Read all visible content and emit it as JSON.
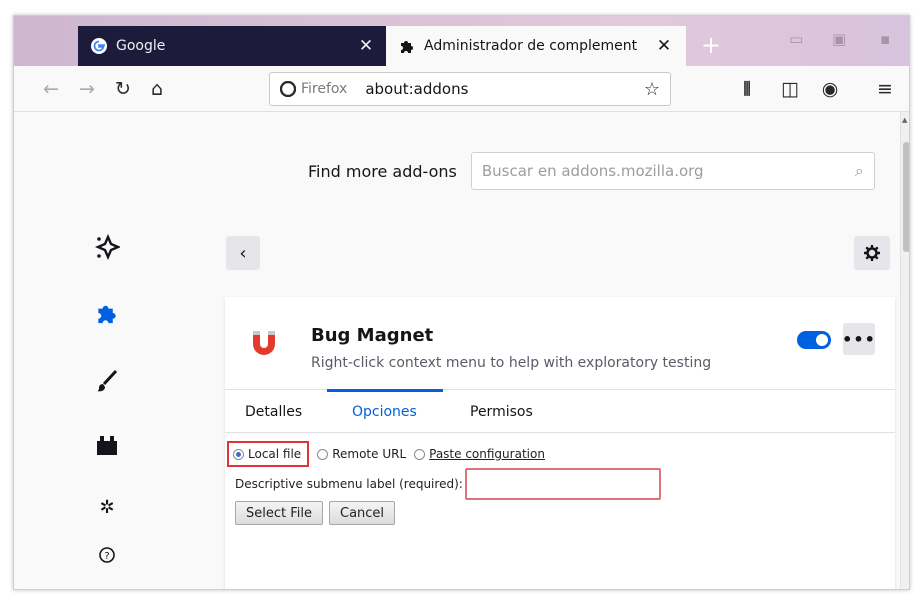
{
  "browser": {
    "tabs": [
      {
        "title": "Google",
        "icon": "google-logo"
      },
      {
        "title": "Administrador de complement",
        "icon": "puzzle-icon"
      }
    ],
    "new_tab_label": "+",
    "url_identity": "Firefox",
    "url": "about:addons"
  },
  "find_more": {
    "label": "Find more add-ons",
    "placeholder": "Buscar en addons.mozilla.org"
  },
  "sidebar": {
    "items": [
      {
        "name": "recommendations",
        "icon": "sparkle-icon"
      },
      {
        "name": "extensions",
        "icon": "puzzle-icon",
        "active": true
      },
      {
        "name": "themes",
        "icon": "brush-icon"
      },
      {
        "name": "plugins",
        "icon": "plugin-block-icon"
      },
      {
        "name": "settings",
        "icon": "gear-icon"
      },
      {
        "name": "help",
        "icon": "help-icon"
      }
    ]
  },
  "addon": {
    "name": "Bug Magnet",
    "description": "Right-click context menu to help with exploratory testing",
    "enabled": true,
    "more_label": "•••"
  },
  "detail_tabs": {
    "details": "Detalles",
    "options": "Opciones",
    "permissions": "Permisos"
  },
  "options_form": {
    "radio_local": "Local file",
    "radio_remote": "Remote URL",
    "radio_paste": "Paste configuration",
    "submenu_label": "Descriptive submenu label (required):",
    "select_file": "Select File",
    "cancel": "Cancel"
  },
  "colors": {
    "accent": "#0061e0",
    "highlight_red": "#e0343a",
    "addon_logo_red": "#e23b2e"
  }
}
